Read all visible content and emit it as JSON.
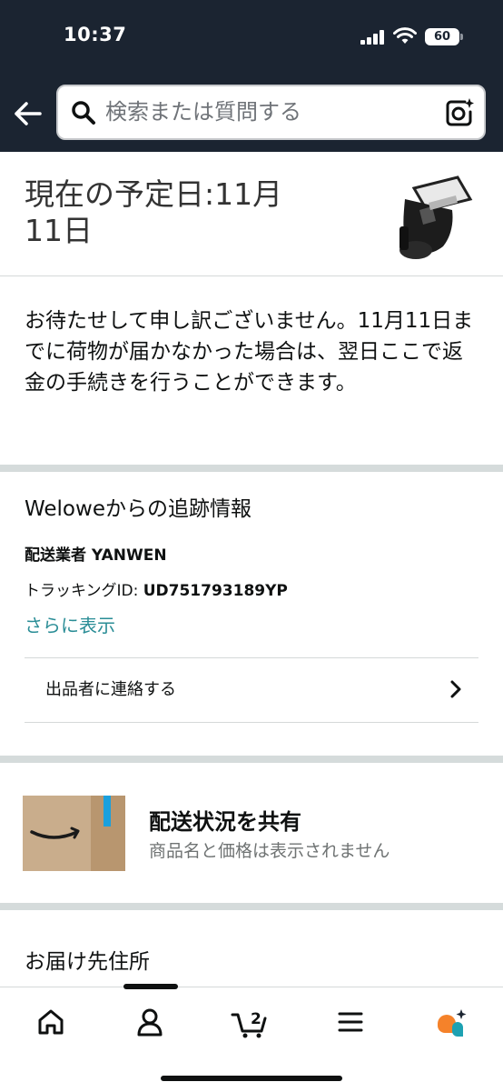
{
  "status_bar": {
    "time": "10:37",
    "battery": "60"
  },
  "header": {
    "search_placeholder": "検索または質問する"
  },
  "delivery": {
    "title": "現在の予定日:11月11日"
  },
  "apology": {
    "text": "お待たせして申し訳ございません。11月11日までに荷物が届かなかった場合は、翌日ここで返金の手続きを行うことができます。"
  },
  "tracking": {
    "heading": "Weloweからの追跡情報",
    "carrier": "配送業者 YANWEN",
    "tracking_id_label": "トラッキングID: ",
    "tracking_id_value": "UD751793189YP",
    "show_more": "さらに表示",
    "contact_seller": "出品者に連絡する"
  },
  "share": {
    "title": "配送状況を共有",
    "subtitle": "商品名と価格は表示されません"
  },
  "address": {
    "heading": "お届け先住所"
  },
  "bottom_nav": {
    "cart_count": "2",
    "items": [
      "home-icon",
      "account-icon",
      "cart-icon",
      "menu-icon",
      "rufus-icon"
    ]
  },
  "colors": {
    "header_bg": "#1b2431",
    "link": "#2a8d96",
    "divider": "#d5dbdb",
    "box_brown": "#c9ad8c",
    "box_tape": "#1aa0dd",
    "rufus_orange": "#f5822a",
    "rufus_teal": "#1da1b2"
  }
}
